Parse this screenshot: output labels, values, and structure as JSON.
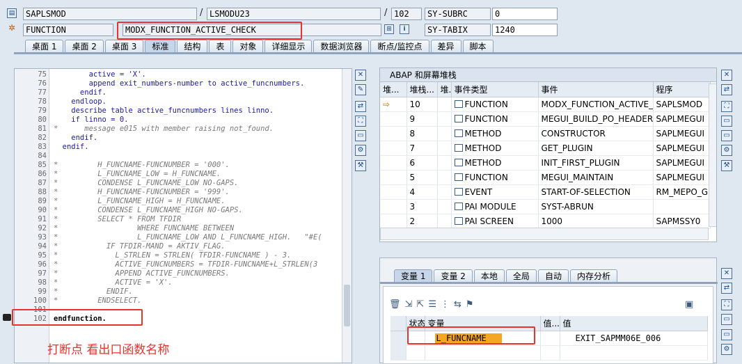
{
  "header": {
    "program": "SAPLSMOD",
    "include": "LSMODU23",
    "line": "102",
    "subrc_label": "SY-SUBRC",
    "subrc_value": "0",
    "type": "FUNCTION",
    "function_name": "MODX_FUNCTION_ACTIVE_CHECK",
    "tabix_label": "SY-TABIX",
    "tabix_value": "1240",
    "slash": "/"
  },
  "tabs": [
    "桌面 1",
    "桌面 2",
    "桌面 3",
    "标准",
    "结构",
    "表",
    "对象",
    "详细显示",
    "数据浏览器",
    "断点/监控点",
    "差异",
    "脚本"
  ],
  "active_tab": "标准",
  "code_lines": [
    {
      "no": "75",
      "code": "        active = 'X'.",
      "style": ""
    },
    {
      "no": "76",
      "code": "        append exit_numbers-number to active_funcnumbers.",
      "style": ""
    },
    {
      "no": "77",
      "code": "      endif.",
      "style": ""
    },
    {
      "no": "78",
      "code": "    endloop.",
      "style": ""
    },
    {
      "no": "79",
      "code": "    describe table active_funcnumbers lines linno.",
      "style": ""
    },
    {
      "no": "80",
      "code": "    if linno = 0.",
      "style": ""
    },
    {
      "no": "81",
      "code": "*      message e015 with member raising not_found.",
      "style": "cm"
    },
    {
      "no": "82",
      "code": "    endif.",
      "style": ""
    },
    {
      "no": "83",
      "code": "  endif.",
      "style": ""
    },
    {
      "no": "84",
      "code": "",
      "style": ""
    },
    {
      "no": "85",
      "code": "*         H_FUNCNAME-FUNCNUMBER = '000'.",
      "style": "cm"
    },
    {
      "no": "86",
      "code": "*         L_FUNCNAME_LOW = H_FUNCNAME.",
      "style": "cm"
    },
    {
      "no": "87",
      "code": "*         CONDENSE L_FUNCNAME_LOW NO-GAPS.",
      "style": "cm"
    },
    {
      "no": "88",
      "code": "*         H_FUNCNAME-FUNCNUMBER = '999'.",
      "style": "cm"
    },
    {
      "no": "89",
      "code": "*         L_FUNCNAME_HIGH = H_FUNCNAME.",
      "style": "cm"
    },
    {
      "no": "90",
      "code": "*         CONDENSE L_FUNCNAME_HIGH NO-GAPS.",
      "style": "cm"
    },
    {
      "no": "91",
      "code": "*         SELECT * FROM TFDIR",
      "style": "cm"
    },
    {
      "no": "92",
      "code": "*                  WHERE FUNCNAME BETWEEN",
      "style": "cm"
    },
    {
      "no": "93",
      "code": "*                  L_FUNCNAME_LOW AND L_FUNCNAME_HIGH.   \"#E(",
      "style": "cm"
    },
    {
      "no": "94",
      "code": "*           IF TFDIR-MAND = AKTIV_FLAG.",
      "style": "cm"
    },
    {
      "no": "95",
      "code": "*             L_STRLEN = STRLEN( TFDIR-FUNCNAME ) - 3.",
      "style": "cm"
    },
    {
      "no": "96",
      "code": "*             ACTIVE_FUNCNUMBERS = TFDIR-FUNCNAME+L_STRLEN(3",
      "style": "cm"
    },
    {
      "no": "97",
      "code": "*             APPEND ACTIVE_FUNCNUMBERS.",
      "style": "cm"
    },
    {
      "no": "98",
      "code": "*             ACTIVE = 'X'.",
      "style": "cm"
    },
    {
      "no": "99",
      "code": "*           ENDIF.",
      "style": "cm"
    },
    {
      "no": "100",
      "code": "*         ENDSELECT.",
      "style": "cm"
    },
    {
      "no": "101",
      "code": "",
      "style": ""
    },
    {
      "no": "102",
      "code": "endfunction.",
      "style": "bold"
    }
  ],
  "annotation": "打断点 看出口函数名称",
  "stack": {
    "title": "ABAP 和屏幕堆栈",
    "headers": [
      "堆...",
      "堆栈...",
      "堆.",
      "事件类型",
      "事件",
      "程序"
    ],
    "rows": [
      {
        "cur": "⇨",
        "depth": "10",
        "type": "FUNCTION",
        "event": "MODX_FUNCTION_ACTIVE_...",
        "program": "SAPLSMOD"
      },
      {
        "cur": "",
        "depth": "9",
        "type": "FUNCTION",
        "event": "MEGUI_BUILD_PO_HEADER_...",
        "program": "SAPLMEGUI"
      },
      {
        "cur": "",
        "depth": "8",
        "type": "METHOD",
        "event": "CONSTRUCTOR",
        "program": "SAPLMEGUI"
      },
      {
        "cur": "",
        "depth": "7",
        "type": "METHOD",
        "event": "GET_PLUGIN",
        "program": "SAPLMEGUI"
      },
      {
        "cur": "",
        "depth": "6",
        "type": "METHOD",
        "event": "INIT_FIRST_PLUGIN",
        "program": "SAPLMEGUI"
      },
      {
        "cur": "",
        "depth": "5",
        "type": "FUNCTION",
        "event": "MEGUI_MAINTAIN",
        "program": "SAPLMEGUI"
      },
      {
        "cur": "",
        "depth": "4",
        "type": "EVENT",
        "event": "START-OF-SELECTION",
        "program": "RM_MEPO_GU"
      },
      {
        "cur": "",
        "depth": "3",
        "type": "PAI MODULE",
        "event": "SYST-ABRUN",
        "program": ""
      },
      {
        "cur": "",
        "depth": "2",
        "type": "PAI SCREEN",
        "event": "1000",
        "program": "SAPMSSY0"
      }
    ]
  },
  "var_tabs": [
    "变量 1",
    "变量 2",
    "本地",
    "全局",
    "自动",
    "内存分析"
  ],
  "var_active": "变量 1",
  "vars": {
    "headers": [
      "状态",
      "变量",
      "值...",
      "值"
    ],
    "row": {
      "name": "L_FUNCNAME",
      "value": "EXIT_SAPMM06E_006"
    }
  },
  "colors": {
    "highlight": "#e8322b",
    "accent": "#f5a623"
  }
}
